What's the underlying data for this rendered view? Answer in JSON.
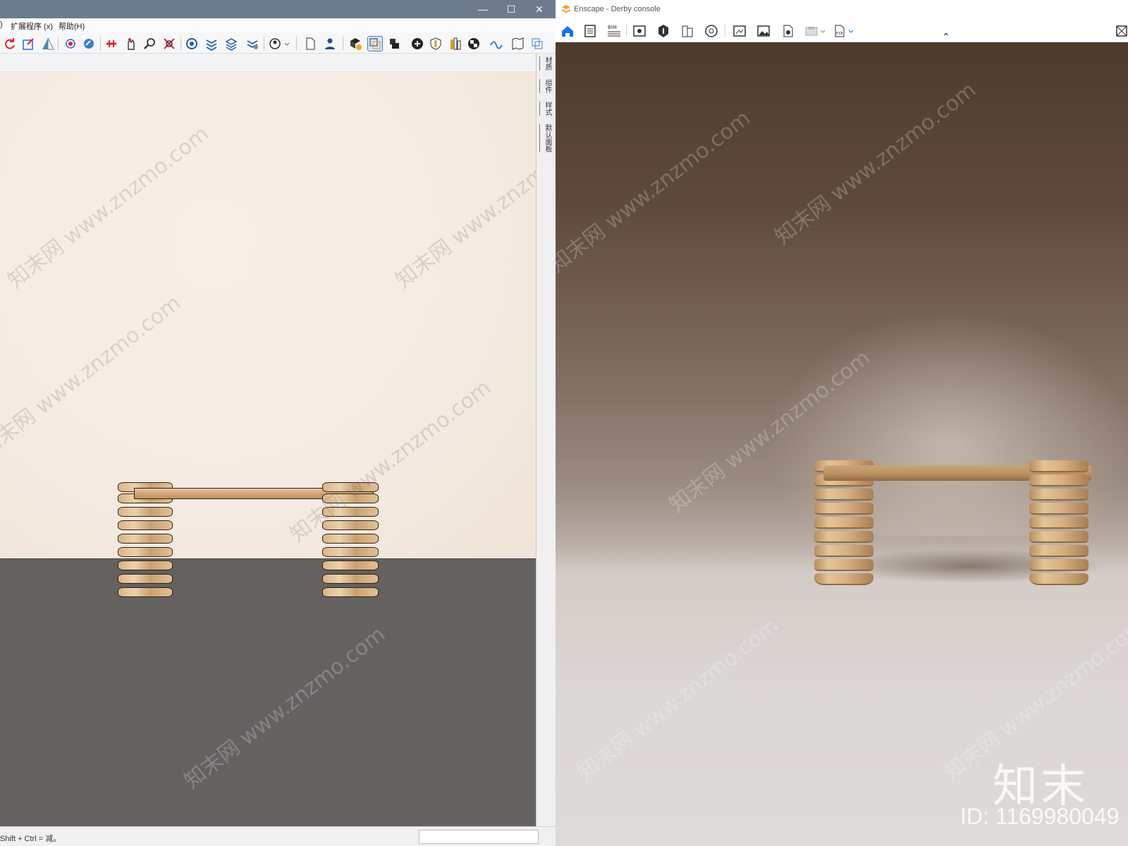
{
  "sketchup": {
    "menu": {
      "partial_left": ")",
      "extensions": "扩展程序 (x)",
      "help": "帮助(H)"
    },
    "window_buttons": {
      "minimize": "—",
      "maximize": "☐",
      "close": "✕"
    },
    "side_tabs": [
      "材质",
      "组件",
      "样式",
      "默认面板"
    ],
    "status_text": "Shift + Ctrl = 减。",
    "colors": {
      "sky": "#f5ebe2",
      "ground": "#646160",
      "titlebar": "#6d7c8c"
    }
  },
  "enscape": {
    "title": "Enscape - Derby console",
    "toolbar_icons": [
      "home-icon",
      "views-icon",
      "bim-icon",
      "visual-settings-icon",
      "vr-icon",
      "building-icon",
      "settings-icon",
      "screenshot-icon",
      "image-icon",
      "batch-render-icon",
      "panorama-icon",
      "export-exe-icon"
    ],
    "bim_label": "BIM",
    "collapse_glyph": "⌃",
    "accent": "#1473e6"
  },
  "watermarks": {
    "text": "知末网 www.znzmo.com"
  },
  "brand": {
    "logo": "知末",
    "id_text": "ID: 1169980049"
  }
}
